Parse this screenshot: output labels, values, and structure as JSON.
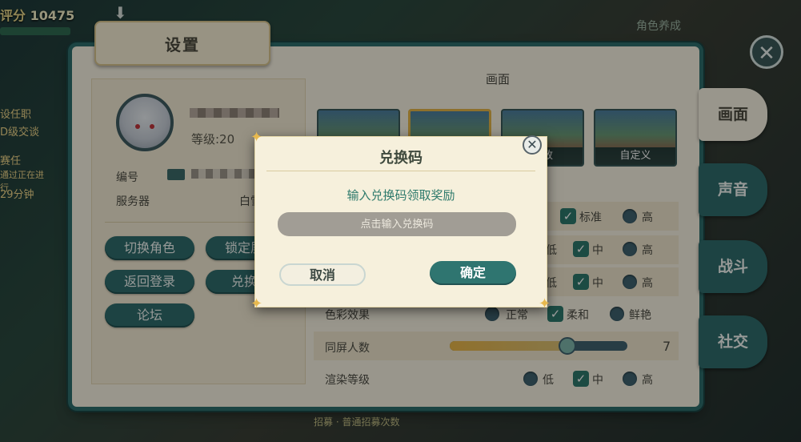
{
  "hud": {
    "score_label": "评分",
    "score_value": "10475",
    "role_label": "角色养成",
    "left_items": [
      "设任职",
      "D级交谈",
      "赛任",
      "通过正在进行",
      "29分钟"
    ],
    "bottom_text": "招募 · 普通招募次数"
  },
  "settings": {
    "title": "设置",
    "close_icon": "close-x-icon",
    "profile": {
      "level_label": "等级:20",
      "id_label": "编号",
      "server_label": "服务器",
      "server_value": "白雪",
      "buttons": [
        "切换角色",
        "锁定屏幕",
        "返回登录",
        "兑换码",
        "论坛"
      ]
    },
    "graphics": {
      "section_title": "画面",
      "presets": [
        {
          "label": ""
        },
        {
          "label": ""
        },
        {
          "label": "极致"
        },
        {
          "label": "自定义"
        }
      ],
      "rows": [
        {
          "label": "",
          "options": [
            "标准",
            "高"
          ],
          "selected": "标准"
        },
        {
          "label": "",
          "options": [
            "低",
            "中",
            "高"
          ],
          "selected": "中"
        },
        {
          "label": "",
          "options": [
            "低",
            "中",
            "高"
          ],
          "selected": "中"
        },
        {
          "label": "色彩效果",
          "options": [
            "正常",
            "柔和",
            "鲜艳"
          ],
          "selected": "柔和"
        },
        {
          "label": "同屏人数",
          "slider_value": "7",
          "slider_fraction": 0.66
        },
        {
          "label": "渲染等级",
          "options": [
            "低",
            "中",
            "高"
          ],
          "selected": "中"
        }
      ]
    },
    "side_tabs": [
      {
        "label": "画面",
        "active": true
      },
      {
        "label": "声音",
        "active": false
      },
      {
        "label": "战斗",
        "active": false
      },
      {
        "label": "社交",
        "active": false
      }
    ]
  },
  "redeem_dialog": {
    "title": "兑换码",
    "subtitle": "输入兑换码领取奖励",
    "input_placeholder": "点击输入兑换码",
    "input_value": "",
    "cancel_label": "取消",
    "confirm_label": "确定"
  },
  "colors": {
    "teal": "#2f6c6c",
    "panel": "#f7f2e2",
    "accent_gold": "#e4b548",
    "subtitle_green": "#2e7a6c"
  }
}
